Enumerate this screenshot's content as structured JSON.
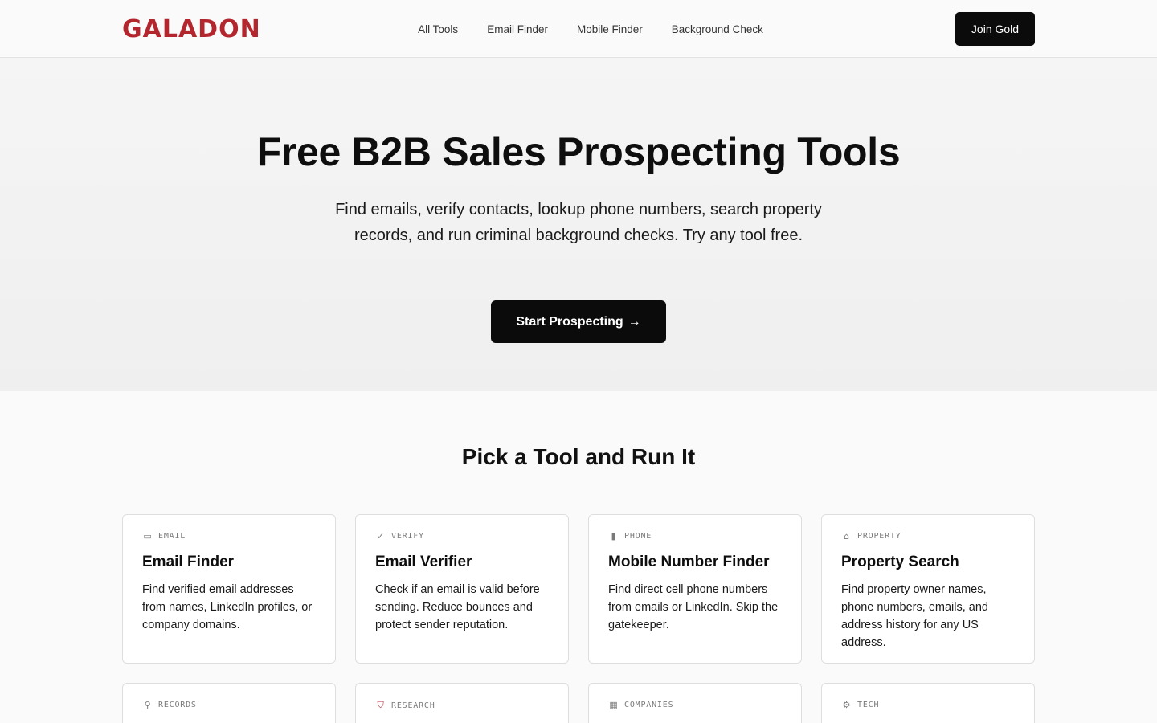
{
  "brand": {
    "name": "GALADON",
    "color": "#b3262d"
  },
  "nav": {
    "links": [
      "All Tools",
      "Email Finder",
      "Mobile Finder",
      "Background Check"
    ],
    "join_label": "Join Gold"
  },
  "hero": {
    "title": "Free B2B Sales Prospecting Tools",
    "subtitle": "Find emails, verify contacts, lookup phone numbers, search property records, and run criminal background checks. Try any tool free.",
    "cta_label": "Start Prospecting",
    "cta_arrow": "→"
  },
  "tools_section": {
    "title": "Pick a Tool and Run It",
    "cards": [
      {
        "tag": "EMAIL",
        "icon": "email-card-icon",
        "glyph": "▭",
        "title": "Email Finder",
        "desc": "Find verified email addresses from names, LinkedIn profiles, or company domains."
      },
      {
        "tag": "VERIFY",
        "icon": "checkmark-icon",
        "glyph": "✓",
        "title": "Email Verifier",
        "desc": "Check if an email is valid before sending. Reduce bounces and protect sender reputation."
      },
      {
        "tag": "PHONE",
        "icon": "mobile-phone-icon",
        "glyph": "▮",
        "title": "Mobile Number Finder",
        "desc": "Find direct cell phone numbers from emails or LinkedIn. Skip the gatekeeper."
      },
      {
        "tag": "PROPERTY",
        "icon": "house-icon",
        "glyph": "⌂",
        "title": "Property Search",
        "desc": "Find property owner names, phone numbers, emails, and address history for any US address."
      },
      {
        "tag": "RECORDS",
        "icon": "magnifier-icon",
        "glyph": "⚲",
        "title": "",
        "desc": ""
      },
      {
        "tag": "RESEARCH",
        "icon": "shield-icon",
        "glyph": "⛉",
        "title": "",
        "desc": ""
      },
      {
        "tag": "COMPANIES",
        "icon": "building-icon",
        "glyph": "▦",
        "title": "",
        "desc": ""
      },
      {
        "tag": "TECH",
        "icon": "gear-icon",
        "glyph": "⚙",
        "title": "",
        "desc": ""
      }
    ]
  }
}
